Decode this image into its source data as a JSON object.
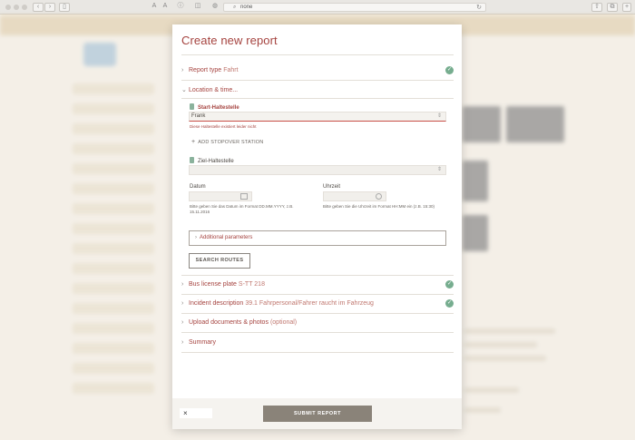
{
  "browser": {
    "url": "none",
    "back_icon": "chevron-left-icon",
    "forward_icon": "chevron-right-icon",
    "sidebar_icon": "sidebar-icon",
    "font_small_label": "A",
    "font_large_label": "A"
  },
  "modal": {
    "title": "Create new report",
    "sections": {
      "report_type": {
        "label": "Report type",
        "value": "Fahrt",
        "complete": true
      },
      "location": {
        "label": "Location & time..."
      },
      "bus_plate": {
        "label": "Bus license plate",
        "value": "S-TT 218",
        "complete": true
      },
      "incident": {
        "label": "Incident description",
        "value": "39.1 Fahrpersonal/Fahrer raucht im Fahrzeug",
        "complete": true
      },
      "upload": {
        "label": "Upload documents & photos",
        "value": "(optional)"
      },
      "summary": {
        "label": "Summary"
      }
    },
    "start_stop": {
      "label": "Start-Haltestelle",
      "value": "Frank",
      "error": "Diese Haltestelle existiert leider nicht"
    },
    "add_stopover_label": "ADD STOPOVER STATION",
    "end_stop": {
      "label": "Ziel-Haltestelle",
      "value": ""
    },
    "date": {
      "label": "Datum",
      "value": "",
      "hint_line1": "Bitte geben Sie das Datum im Format DD.MM.YYYY, z.B.",
      "hint_line2": "15.11.2016"
    },
    "time": {
      "label": "Uhrzeit",
      "value": "",
      "hint": "Bitte geben Sie die Uhrzeit im Format HH:MM ein (z.B. 15:30)"
    },
    "additional_params_label": "Additional parameters",
    "search_routes_label": "SEARCH ROUTES",
    "close_label": "×",
    "submit_label": "SUBMIT REPORT"
  },
  "colors": {
    "accent": "#a5433f",
    "success": "#76ad8f",
    "button": "#8a8379"
  }
}
